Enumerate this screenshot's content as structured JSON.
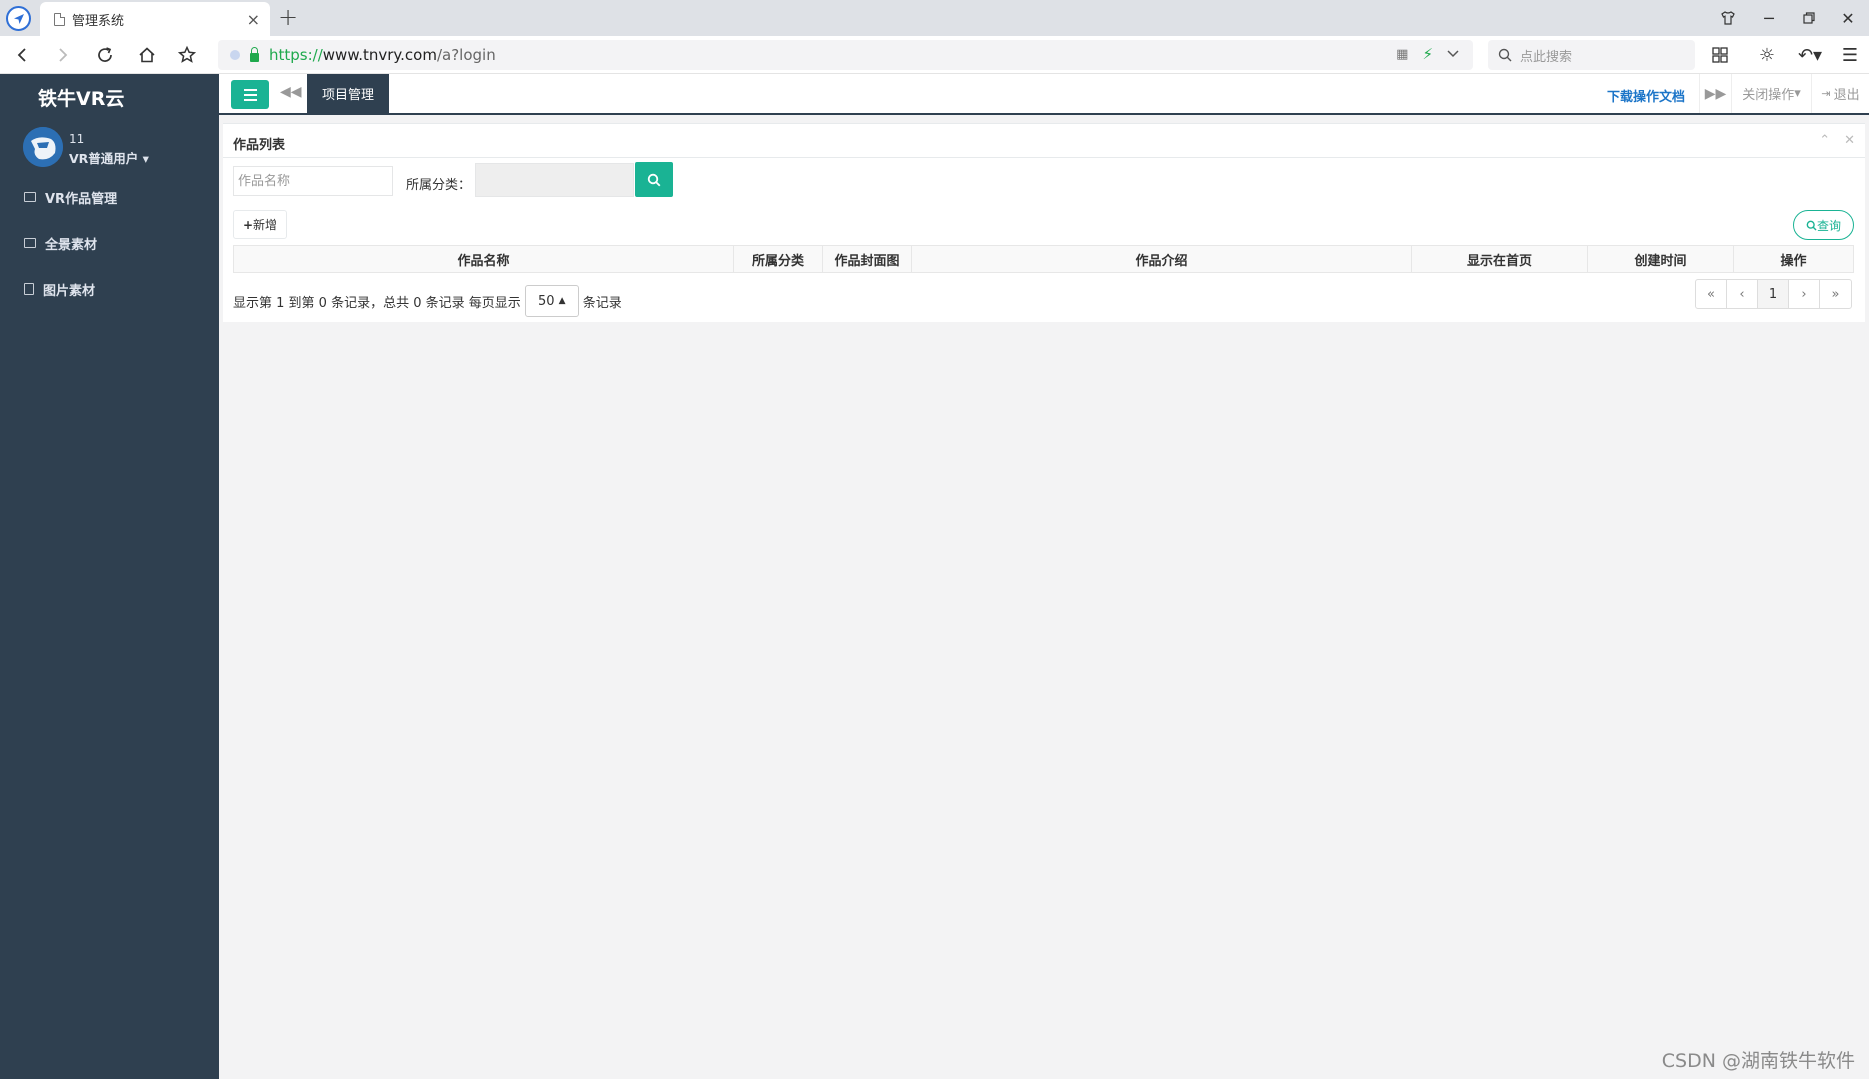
{
  "browser": {
    "tab_title": "管理系统",
    "url_proto": "https://",
    "url_domain": "www.tnvry.com",
    "url_path": "/a?login",
    "search_placeholder": "点此搜索"
  },
  "sidebar": {
    "brand": "铁牛VR云",
    "user_name": "11",
    "user_role": "VR普通用户",
    "items": [
      {
        "label": "VR作品管理"
      },
      {
        "label": "全景素材"
      },
      {
        "label": "图片素材"
      }
    ]
  },
  "topbar": {
    "active_tab": "项目管理",
    "download_doc": "下载操作文档",
    "close_ops": "关闭操作",
    "logout": "退出"
  },
  "panel": {
    "title": "作品列表",
    "name_placeholder": "作品名称",
    "category_label": "所属分类：",
    "add_label": "新增",
    "query_label": "查询",
    "columns": [
      "作品名称",
      "所属分类",
      "作品封面图",
      "作品介绍",
      "显示在首页",
      "创建时间",
      "操作"
    ],
    "page_info_prefix": "显示第 1 到第 0 条记录，总共 0 条记录 每页显示",
    "page_size": "50",
    "page_info_suffix": "条记录",
    "current_page": "1"
  },
  "watermark": "CSDN @湖南铁牛软件",
  "colors": {
    "sidebar_bg": "#2f4050",
    "accent": "#1ab394",
    "link": "#1c75c8"
  }
}
